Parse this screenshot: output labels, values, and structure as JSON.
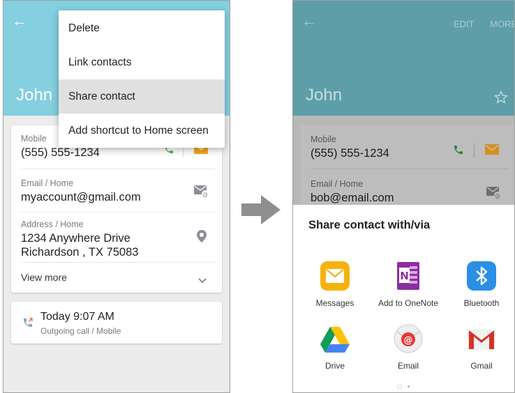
{
  "left": {
    "contact_name": "John",
    "menu": {
      "items": [
        "Delete",
        "Link contacts",
        "Share contact",
        "Add shortcut to Home screen"
      ],
      "selected": "Share contact"
    },
    "mobile": {
      "label": "Mobile",
      "value": "(555) 555-1234"
    },
    "email": {
      "label": "Email / Home",
      "value": "myaccount@gmail.com"
    },
    "address": {
      "label": "Address / Home",
      "line1": "1234 Anywhere Drive",
      "line2": "Richardson , TX 75083"
    },
    "view_more": "View more",
    "call_log": {
      "time": "Today 9:07 AM",
      "detail": "Outgoing call / Mobile"
    },
    "colors": {
      "header": "#84cfe0",
      "accent_call": "#4caf50",
      "accent_msg": "#f5a623"
    }
  },
  "right": {
    "contact_name": "John",
    "actions": {
      "edit": "EDIT",
      "more": "MORE"
    },
    "mobile": {
      "label": "Mobile",
      "value": "(555) 555-1234"
    },
    "email": {
      "label": "Email / Home",
      "value": "bob@email.com"
    },
    "share": {
      "title": "Share contact with/via",
      "apps": [
        {
          "name": "Messages",
          "icon": "messages-icon"
        },
        {
          "name": "Add to OneNote",
          "icon": "onenote-icon"
        },
        {
          "name": "Bluetooth",
          "icon": "bluetooth-icon"
        },
        {
          "name": "Drive",
          "icon": "drive-icon"
        },
        {
          "name": "Email",
          "icon": "email-icon"
        },
        {
          "name": "Gmail",
          "icon": "gmail-icon"
        }
      ],
      "page_count": 2,
      "current_page": 1
    },
    "colors": {
      "header": "#5e9ea8"
    }
  }
}
